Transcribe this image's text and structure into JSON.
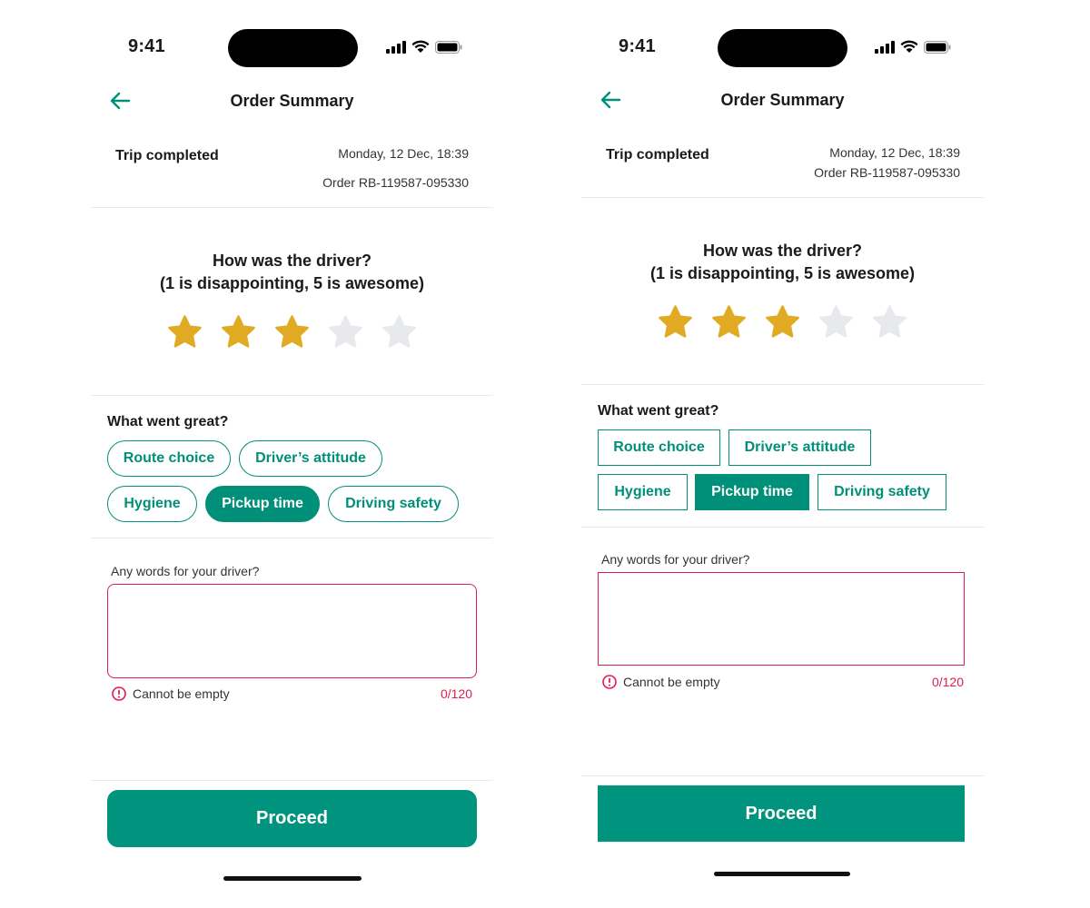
{
  "screens": [
    {
      "variant": "rounded",
      "status_bar": {
        "time": "9:41"
      },
      "header": {
        "title": "Order Summary"
      },
      "trip": {
        "status": "Trip completed",
        "date": "Monday, 12 Dec, 18:39",
        "order": "Order RB-119587-095330"
      },
      "rating": {
        "question_line1": "How was the driver?",
        "question_line2": "(1 is disappointing, 5 is awesome)",
        "value": 3,
        "max": 5
      },
      "feedback": {
        "label": "What went great?",
        "chips": [
          {
            "label": "Route choice",
            "selected": false
          },
          {
            "label": "Driver’s attitude",
            "selected": false
          },
          {
            "label": "Hygiene",
            "selected": false
          },
          {
            "label": "Pickup time",
            "selected": true
          },
          {
            "label": "Driving safety",
            "selected": false
          }
        ]
      },
      "comment": {
        "label": "Any words for your driver?",
        "value": "",
        "error": "Cannot be empty",
        "counter": "0/120"
      },
      "proceed_label": "Proceed"
    },
    {
      "variant": "square",
      "status_bar": {
        "time": "9:41"
      },
      "header": {
        "title": "Order Summary"
      },
      "trip": {
        "status": "Trip completed",
        "date": "Monday, 12 Dec, 18:39",
        "order": "Order RB-119587-095330"
      },
      "rating": {
        "question_line1": "How was the driver?",
        "question_line2": "(1 is disappointing, 5 is awesome)",
        "value": 3,
        "max": 5
      },
      "feedback": {
        "label": "What went great?",
        "chips": [
          {
            "label": "Route choice",
            "selected": false
          },
          {
            "label": "Driver’s attitude",
            "selected": false
          },
          {
            "label": "Hygiene",
            "selected": false
          },
          {
            "label": "Pickup time",
            "selected": true
          },
          {
            "label": "Driving safety",
            "selected": false
          }
        ]
      },
      "comment": {
        "label": "Any words for your driver?",
        "value": "",
        "error": "Cannot be empty",
        "counter": "0/120"
      },
      "proceed_label": "Proceed"
    }
  ],
  "colors": {
    "accent": "#008f78",
    "star_filled": "#e0ab22",
    "star_empty": "#e8e9ec",
    "error": "#e01d4f"
  },
  "icons": {
    "back": "arrow-left-icon",
    "error": "alert-circle-icon",
    "star": "star-icon",
    "signal": "cellular-signal-icon",
    "wifi": "wifi-icon",
    "battery": "battery-icon"
  }
}
